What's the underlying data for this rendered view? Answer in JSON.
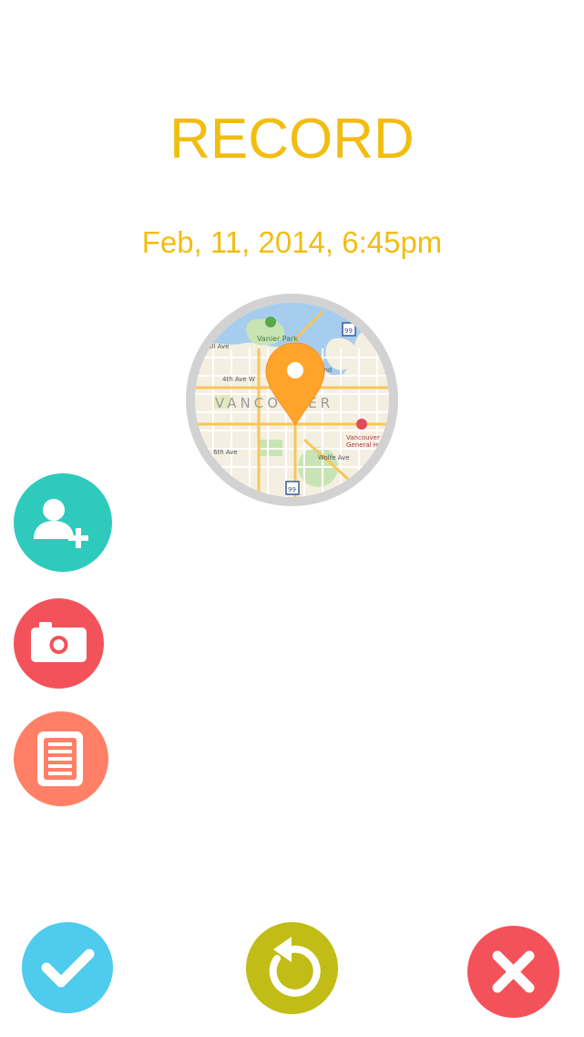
{
  "header": {
    "title": "RECORD",
    "datetime": "Feb, 11, 2014, 6:45pm"
  },
  "map": {
    "labels": {
      "park": "Vanier Park",
      "island": "Granville Island",
      "city": "VANCOUVER",
      "hospital_line1": "Vancouver",
      "hospital_line2": "General Hosp",
      "street1": "nwall Ave",
      "street2": "4th Ave W",
      "street3": "6th Ave",
      "street4": "W 6th Ave",
      "street5": "Wolfe Ave",
      "route1": "99",
      "route2": "99"
    },
    "pin_color": "#ffa42b"
  },
  "actions": {
    "add_contact_icon": "add-person-icon",
    "camera_icon": "camera-icon",
    "note_icon": "document-icon"
  },
  "bottom_bar": {
    "confirm_icon": "checkmark-icon",
    "reset_icon": "undo-icon",
    "cancel_icon": "close-icon"
  },
  "colors": {
    "accent": "#f2bd11",
    "teal": "#2ecbbd",
    "red": "#f4525a",
    "orange": "#ff8066",
    "blue": "#4ecbed",
    "olive": "#c2bd16"
  }
}
